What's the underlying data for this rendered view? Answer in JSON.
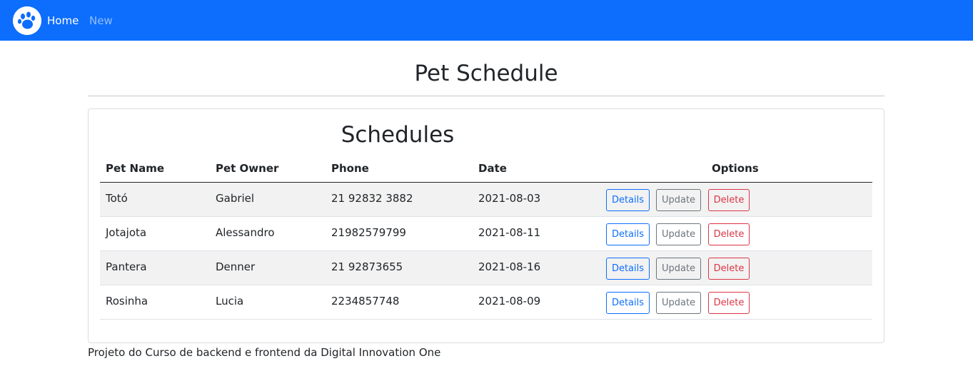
{
  "nav": {
    "brand_icon": "paw-icon",
    "brand_color": "#0d6efd",
    "links": [
      {
        "label": "Home",
        "active": true
      },
      {
        "label": "New",
        "active": false
      }
    ]
  },
  "page": {
    "title": "Pet Schedule"
  },
  "card": {
    "title": "Schedules",
    "columns": [
      "Pet Name",
      "Pet Owner",
      "Phone",
      "Date",
      "Options"
    ],
    "rows": [
      {
        "pet_name": "Totó",
        "pet_owner": "Gabriel",
        "phone": "21 92832 3882",
        "date": "2021-08-03"
      },
      {
        "pet_name": "Jotajota",
        "pet_owner": "Alessandro",
        "phone": "21982579799",
        "date": "2021-08-11"
      },
      {
        "pet_name": "Pantera",
        "pet_owner": "Denner",
        "phone": "21 92873655",
        "date": "2021-08-16"
      },
      {
        "pet_name": "Rosinha",
        "pet_owner": "Lucia",
        "phone": "2234857748",
        "date": "2021-08-09"
      }
    ],
    "actions": {
      "details": "Details",
      "update": "Update",
      "delete": "Delete"
    }
  },
  "footer": {
    "text": "Projeto do Curso de backend e frontend da Digital Innovation One"
  }
}
